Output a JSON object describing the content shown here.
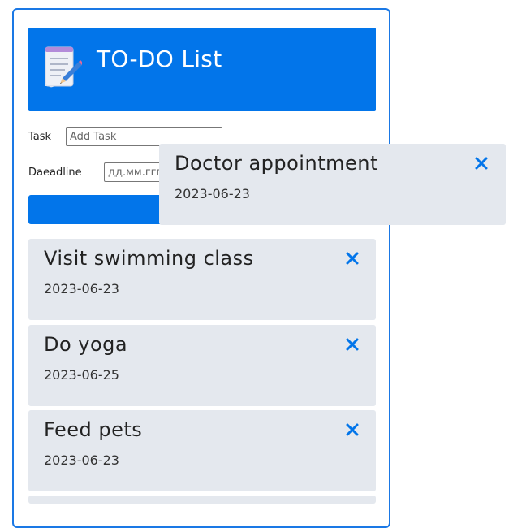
{
  "header": {
    "title": "TO-DO List",
    "icon": "notepad-pencil-icon"
  },
  "form": {
    "task_label": "Task",
    "task_placeholder": "Add Task",
    "deadline_label": "Daeadline",
    "deadline_placeholder": "дд.мм.гггг"
  },
  "colors": {
    "accent": "#0275ea",
    "card_bg": "#e4e8ee",
    "close_icon": "#0275ea"
  },
  "tasks": [
    {
      "name": "Visit swimming class",
      "date": "2023-06-23"
    },
    {
      "name": "Do yoga",
      "date": "2023-06-25"
    },
    {
      "name": "Feed pets",
      "date": "2023-06-23"
    }
  ],
  "dragging": {
    "name": "Doctor appointment",
    "date": "2023-06-23"
  }
}
